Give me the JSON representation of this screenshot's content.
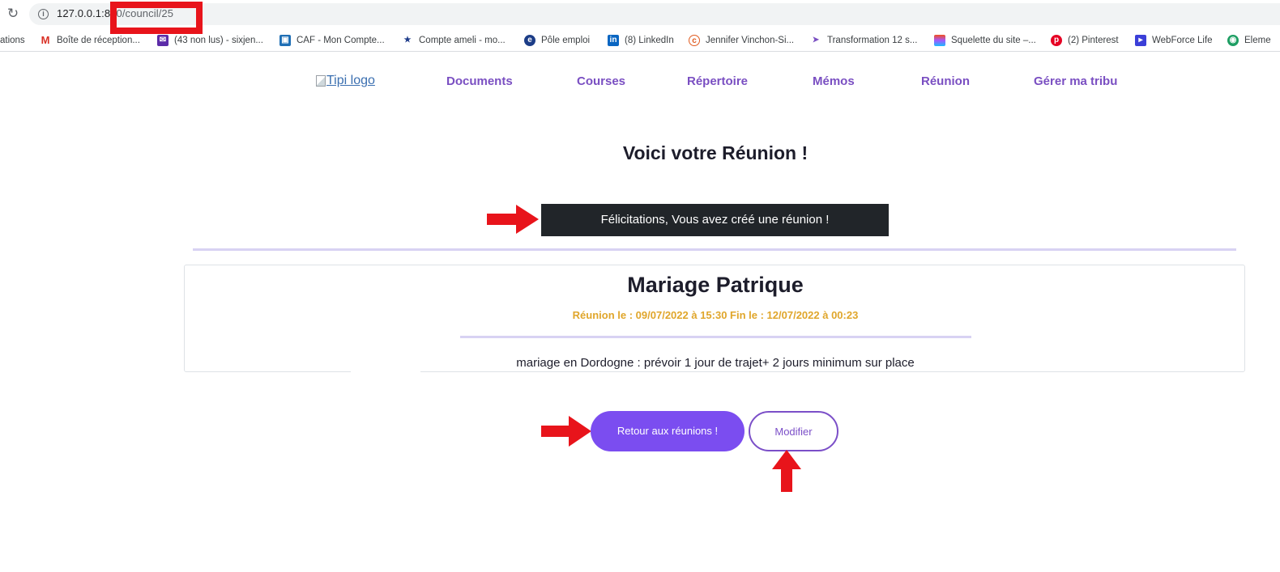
{
  "browser": {
    "url_host": "127.0.0.1:8",
    "url_path": "00/council/25"
  },
  "bookmarks": [
    {
      "label": "ations",
      "icon": "none"
    },
    {
      "label": "Boîte de réception...",
      "icon": "gmail-icon"
    },
    {
      "label": "(43 non lus) - sixjen...",
      "icon": "mail-icon"
    },
    {
      "label": "CAF - Mon Compte...",
      "icon": "caf-icon"
    },
    {
      "label": "Compte ameli - mo...",
      "icon": "ameli-icon"
    },
    {
      "label": "Pôle emploi",
      "icon": "pole-emploi-icon"
    },
    {
      "label": "(8) LinkedIn",
      "icon": "linkedin-icon"
    },
    {
      "label": "Jennifer Vinchon-Si...",
      "icon": "site-icon"
    },
    {
      "label": "Transformation 12 s...",
      "icon": "site-icon"
    },
    {
      "label": "Squelette du site –...",
      "icon": "figma-icon"
    },
    {
      "label": "(2) Pinterest",
      "icon": "pinterest-icon"
    },
    {
      "label": "WebForce Life",
      "icon": "webforce-icon"
    },
    {
      "label": "Eleme",
      "icon": "site-icon"
    }
  ],
  "nav": {
    "logo_alt": "Tipi logo",
    "items": [
      "Documents",
      "Courses",
      "Répertoire",
      "Mémos",
      "Réunion",
      "Gérer ma tribu"
    ]
  },
  "page": {
    "title": "Voici votre Réunion !",
    "alert": "Félicitations, Vous avez créé une réunion !"
  },
  "meeting": {
    "title": "Mariage Patrique",
    "dates": "Réunion le : 09/07/2022 à 15:30 Fin le : 12/07/2022 à 00:23",
    "description": "mariage en Dordogne : prévoir 1 jour de trajet+ 2 jours minimum sur place"
  },
  "actions": {
    "back_label": "Retour aux réunions !",
    "edit_label": "Modifier"
  },
  "colors": {
    "accent": "#7b4df0",
    "nav_link": "#7a4fc2",
    "date_text": "#e0a62b",
    "alert_bg": "#212529",
    "annotation_red": "#e8141b"
  }
}
